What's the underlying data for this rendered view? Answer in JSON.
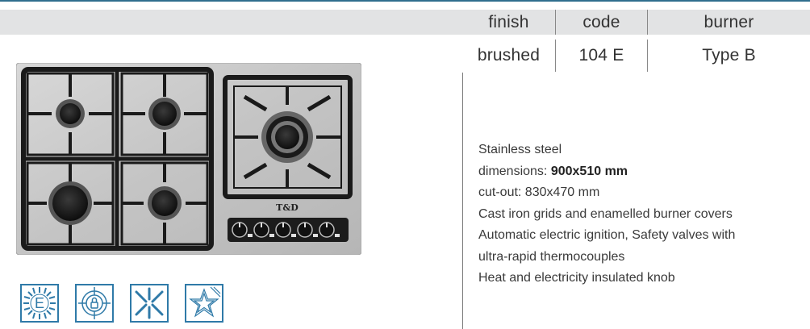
{
  "specs": {
    "headers": [
      "finish",
      "code",
      "burner"
    ],
    "values": [
      "brushed",
      "104 E",
      "Type B"
    ]
  },
  "product": {
    "brand_logo_text": "T&D"
  },
  "description": {
    "line1": "Stainless steel",
    "line2_label": "dimensions: ",
    "line2_value": "900x510 mm",
    "line3": "cut-out: 830x470 mm",
    "line4": "Cast iron grids and enamelled burner covers",
    "line5": "Automatic electric ignition, Safety valves with",
    "line6": "ultra-rapid thermocouples",
    "line7": "Heat and electricity insulated knob"
  },
  "badges": {
    "energy_letter": "E",
    "icons": [
      "energy-e-icon",
      "safety-lock-icon",
      "electric-ignition-icon",
      "star-icon"
    ]
  },
  "colors": {
    "accent": "#2f7aa8",
    "band": "#e2e3e4",
    "steel": "#c9c9c9",
    "cast_iron": "#1e1e1e"
  }
}
